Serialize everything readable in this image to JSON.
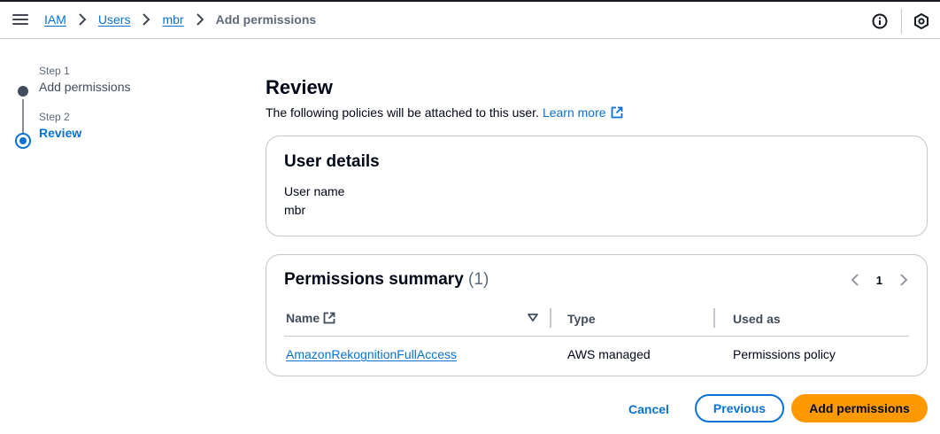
{
  "breadcrumb": {
    "items": [
      "IAM",
      "Users",
      "mbr"
    ],
    "current": "Add permissions"
  },
  "steps": [
    {
      "number": "Step 1",
      "title": "Add permissions",
      "state": "complete"
    },
    {
      "number": "Step 2",
      "title": "Review",
      "state": "active"
    }
  ],
  "main": {
    "title": "Review",
    "description": "The following policies will be attached to this user.",
    "learn_more": "Learn more"
  },
  "user_details": {
    "title": "User details",
    "label": "User name",
    "value": "mbr"
  },
  "permissions_summary": {
    "title": "Permissions summary",
    "count": "(1)",
    "page": "1",
    "columns": {
      "name": "Name",
      "type": "Type",
      "used_as": "Used as"
    },
    "rows": [
      {
        "name": "AmazonRekognitionFullAccess",
        "type": "AWS managed",
        "used_as": "Permissions policy"
      }
    ]
  },
  "actions": {
    "cancel": "Cancel",
    "previous": "Previous",
    "add": "Add permissions"
  },
  "icons": {
    "menu": "hamburger-menu-icon",
    "info": "info-icon",
    "settings": "settings-icon",
    "external": "external-link-icon",
    "sort": "sort-down-icon"
  },
  "colors": {
    "link": "#0972d3",
    "primary_button": "#ff9900",
    "text": "#000716",
    "muted": "#5f6b7a",
    "border": "#c6c6cd"
  }
}
